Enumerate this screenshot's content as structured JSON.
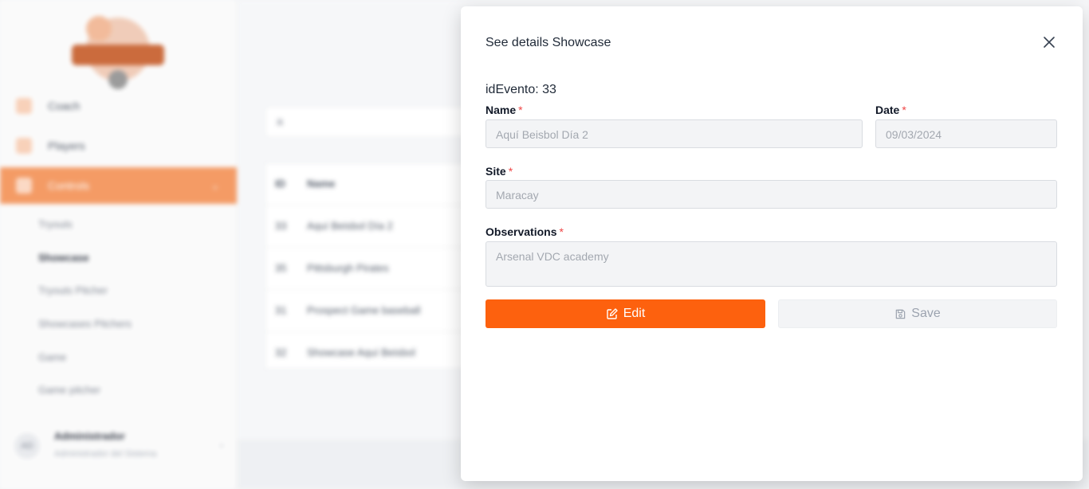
{
  "background": {
    "sidebar": {
      "items": [
        {
          "label": "Coach",
          "active": false
        },
        {
          "label": "Players",
          "active": false
        },
        {
          "label": "Controls",
          "active": true
        }
      ],
      "subitems": [
        "Tryouts",
        "Showcase",
        "Tryouts Pitcher",
        "Showcases Pitchers",
        "Game",
        "Game pitcher"
      ],
      "user": {
        "initials": "AD",
        "name": "Administrador",
        "role": "Administrador del Sistema"
      }
    },
    "filter_placeholder": "a",
    "table": {
      "headers": [
        "ID",
        "Name"
      ],
      "rows": [
        [
          "33",
          "Aquí Beisbol Día 2"
        ],
        [
          "35",
          "Pittsburgh Pirates"
        ],
        [
          "31",
          "Prospect Game baseball"
        ],
        [
          "32",
          "Showcase Aquí Beisbol"
        ]
      ]
    }
  },
  "modal": {
    "title": "See details Showcase",
    "id_label": "idEvento: 33",
    "fields": {
      "name": {
        "label": "Name",
        "value": "Aquí Beisbol Día 2"
      },
      "date": {
        "label": "Date",
        "value": "09/03/2024"
      },
      "site": {
        "label": "Site",
        "value": "Maracay"
      },
      "observations": {
        "label": "Observations",
        "value": "Arsenal VDC academy"
      }
    },
    "required_mark": "*",
    "edit_label": "Edit",
    "save_label": "Save"
  },
  "colors": {
    "accent": "#fd610e",
    "required": "#ef4444",
    "sidebar_active": "#f28a4b"
  },
  "icons": {
    "close": "close-icon",
    "edit": "edit-icon",
    "save": "save-icon"
  }
}
